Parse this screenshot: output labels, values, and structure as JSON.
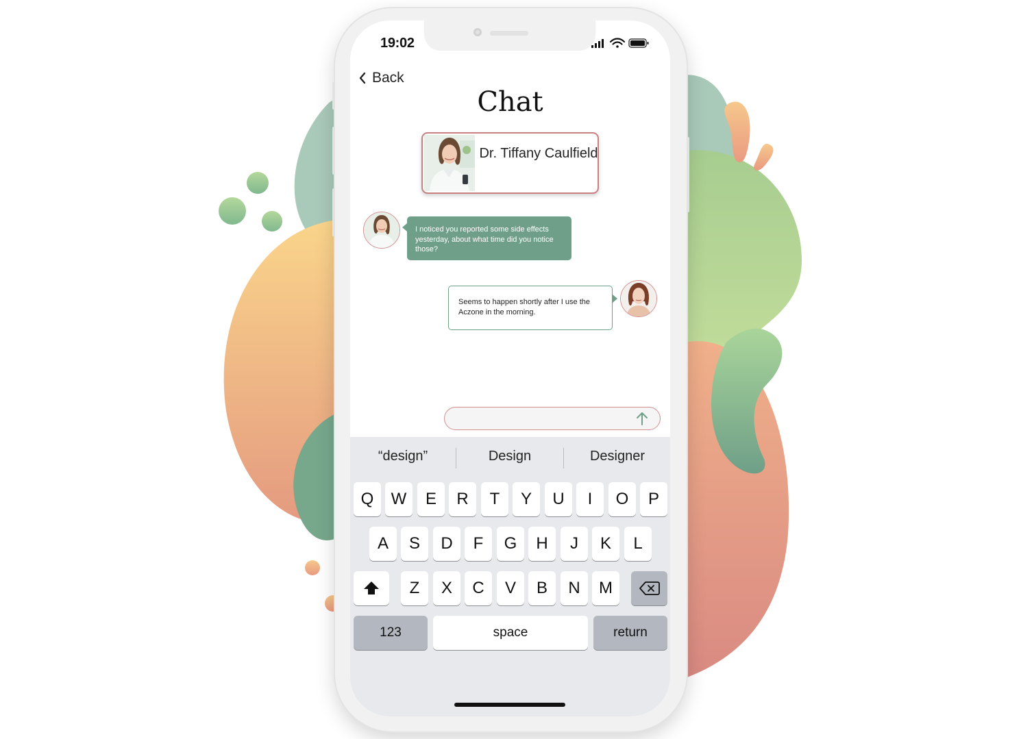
{
  "status_bar": {
    "time": "19:02",
    "icons": [
      "signal-icon",
      "wifi-icon",
      "battery-icon"
    ]
  },
  "nav": {
    "back_label": "Back",
    "back_icon": "chevron-left-icon"
  },
  "page": {
    "title": "Chat"
  },
  "contact": {
    "name": "Dr. Tiffany Caulfield"
  },
  "messages": [
    {
      "from": "doctor",
      "text": "I noticed you reported some side effects yesterday, about what time did you notice those?"
    },
    {
      "from": "patient",
      "text": "Seems to happen shortly after I use the Aczone in the morning."
    }
  ],
  "composer": {
    "value": "",
    "send_icon": "arrow-up-icon"
  },
  "keyboard": {
    "suggestions": [
      "“design”",
      "Design",
      "Designer"
    ],
    "row1": [
      "Q",
      "W",
      "E",
      "R",
      "T",
      "Y",
      "U",
      "I",
      "O",
      "P"
    ],
    "row2": [
      "A",
      "S",
      "D",
      "F",
      "G",
      "H",
      "J",
      "K",
      "L"
    ],
    "row3": [
      "Z",
      "X",
      "C",
      "V",
      "B",
      "N",
      "M"
    ],
    "numbers_label": "123",
    "space_label": "space",
    "return_label": "return",
    "shift_icon": "shift-icon",
    "delete_icon": "backspace-icon"
  },
  "colors": {
    "accent_green": "#6f9f88",
    "accent_rose": "#c88080",
    "keyboard_bg": "#e8e9ec"
  }
}
